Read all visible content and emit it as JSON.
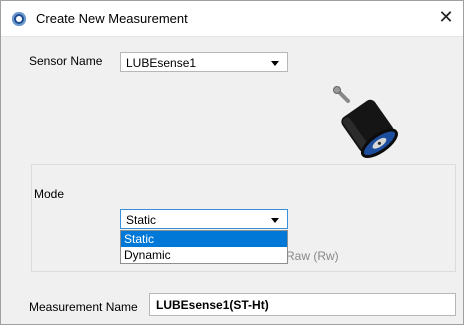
{
  "window": {
    "title": "Create New Measurement",
    "close_glyph": "✕"
  },
  "sensor": {
    "label": "Sensor Name",
    "selected": "LUBEsense1"
  },
  "mode": {
    "label": "Mode",
    "selected": "Static",
    "options": [
      "Static",
      "Dynamic"
    ],
    "highlighted_option": "Static",
    "partial_text": "Raw (Rw)"
  },
  "measurement": {
    "label": "Measurement Name",
    "value": "LUBEsense1(ST-Ht)"
  },
  "colors": {
    "selection": "#0078d7",
    "sensor_body": "#1a1a1a",
    "sensor_face": "#1d4e9e"
  }
}
